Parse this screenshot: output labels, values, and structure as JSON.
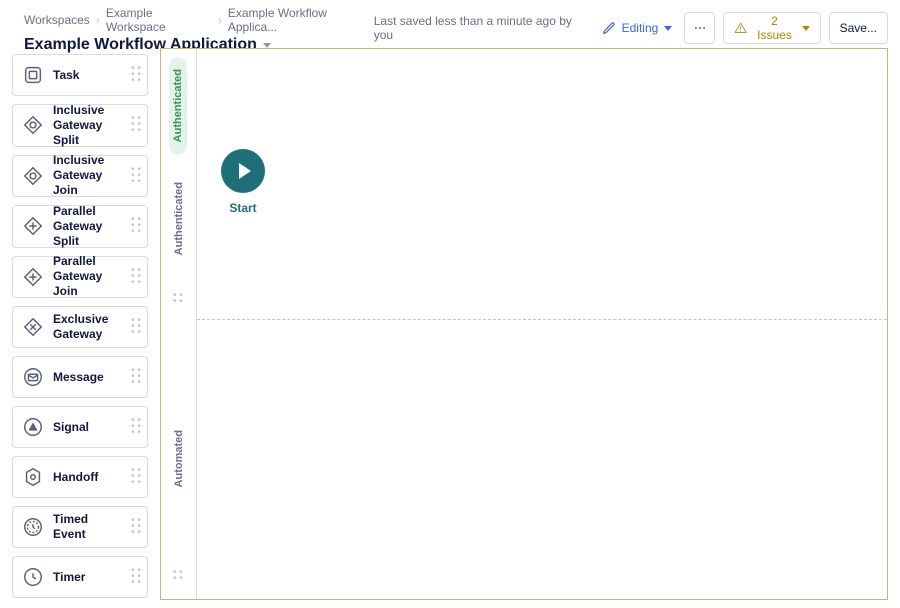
{
  "breadcrumbs": [
    "Workspaces",
    "Example Workspace",
    "Example Workflow Applica..."
  ],
  "page_title": "Example Workflow Application",
  "header": {
    "last_saved": "Last saved less than a minute ago by you",
    "editing_label": "Editing",
    "issues_label": "2 Issues",
    "save_label": "Save..."
  },
  "palette": [
    {
      "key": "task",
      "label": "Task",
      "icon": "task-icon"
    },
    {
      "key": "inclusive-split",
      "label": "Inclusive Gateway Split",
      "icon": "inclusive-gateway-icon"
    },
    {
      "key": "inclusive-join",
      "label": "Inclusive Gateway Join",
      "icon": "inclusive-gateway-icon"
    },
    {
      "key": "parallel-split",
      "label": "Parallel Gateway Split",
      "icon": "parallel-gateway-icon"
    },
    {
      "key": "parallel-join",
      "label": "Parallel Gateway Join",
      "icon": "parallel-gateway-icon"
    },
    {
      "key": "exclusive-gateway",
      "label": "Exclusive Gateway",
      "icon": "exclusive-gateway-icon"
    },
    {
      "key": "message",
      "label": "Message",
      "icon": "message-icon"
    },
    {
      "key": "signal",
      "label": "Signal",
      "icon": "signal-icon"
    },
    {
      "key": "handoff",
      "label": "Handoff",
      "icon": "handoff-icon"
    },
    {
      "key": "timed-event",
      "label": "Timed Event",
      "icon": "timed-event-icon"
    },
    {
      "key": "timer",
      "label": "Timer",
      "icon": "timer-icon"
    }
  ],
  "swimlanes": {
    "lane1_pill": "Authenticated",
    "lane1_label": "Authenticated",
    "lane2_label": "Automated"
  },
  "nodes": {
    "start_label": "Start"
  }
}
